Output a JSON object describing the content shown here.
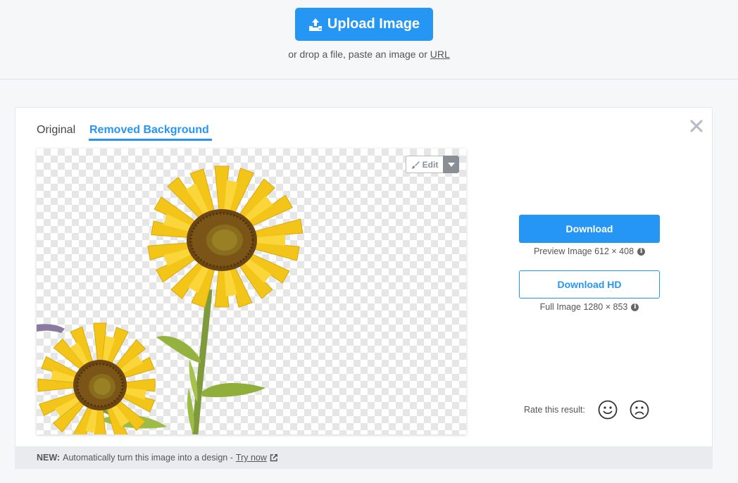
{
  "header": {
    "upload_label": "Upload Image",
    "drop_text": "or drop a file, paste an image or",
    "url_link": "URL"
  },
  "tabs": {
    "original": "Original",
    "removed": "Removed Background"
  },
  "editor": {
    "edit_label": "Edit"
  },
  "download": {
    "button": "Download",
    "preview_info": "Preview Image 612 × 408",
    "hd_button": "Download HD",
    "full_info": "Full Image 1280 × 853"
  },
  "rating": {
    "label": "Rate this result:"
  },
  "footer": {
    "new_label": "NEW:",
    "text": "Automatically turn this image into a design -",
    "link": "Try now"
  },
  "colors": {
    "accent": "#2596f3",
    "footer_bg": "#e9ebee",
    "page_bg": "#f6f7f9"
  },
  "icons": [
    "upload-icon",
    "close-icon",
    "brush-icon",
    "caret-down-icon",
    "info-icon",
    "smiley-happy-icon",
    "smiley-sad-icon",
    "external-link-icon"
  ]
}
